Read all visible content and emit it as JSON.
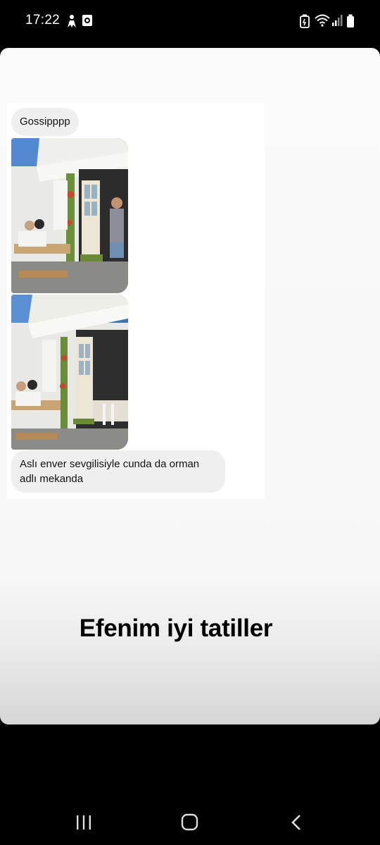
{
  "status_bar": {
    "time": "17:22",
    "icons_left": [
      "person-notification-icon",
      "camera-notification-icon"
    ],
    "icons_right": [
      "battery-saver-icon",
      "wifi-icon",
      "signal-icon",
      "battery-icon"
    ]
  },
  "story": {
    "messages": [
      {
        "type": "text",
        "text": "Gossipppp"
      },
      {
        "type": "image",
        "icon": "cafe-photo"
      },
      {
        "type": "image",
        "icon": "cafe-photo"
      },
      {
        "type": "text",
        "text": "Aslı enver sevgilisiyle cunda da orman adlı mekanda"
      }
    ],
    "caption": "Efenim iyi tatiller"
  },
  "nav_bar": {
    "buttons": [
      "recents-icon",
      "home-icon",
      "back-icon"
    ]
  }
}
